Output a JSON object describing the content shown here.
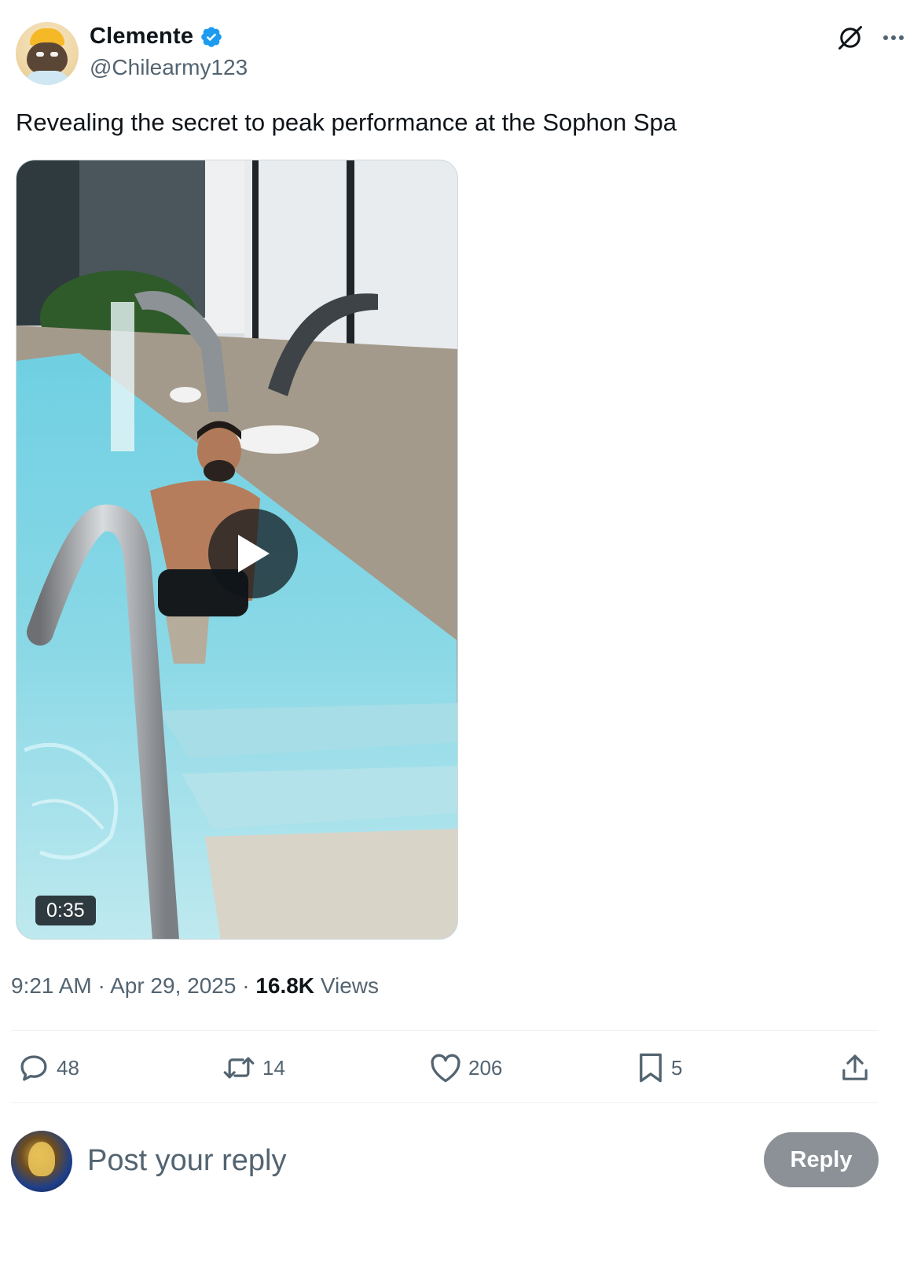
{
  "author": {
    "display_name": "Clemente",
    "handle": "@Chilearmy123",
    "verified": true
  },
  "icons": {
    "verified": "verified-badge-icon",
    "grok": "grok-icon",
    "more": "more-icon",
    "reply": "reply-icon",
    "repost": "repost-icon",
    "like": "like-icon",
    "bookmark": "bookmark-icon",
    "share": "share-icon",
    "play": "play-icon"
  },
  "post": {
    "text": "Revealing the secret to peak performance at the Sophon Spa",
    "video": {
      "duration": "0:35"
    },
    "time": "9:21 AM",
    "separator": "·",
    "date": "Apr 29, 2025",
    "views_count": "16.8K",
    "views_label": "Views"
  },
  "stats": {
    "replies": "48",
    "reposts": "14",
    "likes": "206",
    "bookmarks": "5"
  },
  "reply_box": {
    "placeholder": "Post your reply",
    "button_label": "Reply"
  },
  "colors": {
    "text_primary": "#0f1419",
    "text_secondary": "#536471",
    "verified_blue": "#1d9bf0",
    "divider": "#eff3f4",
    "reply_button_disabled": "#8b9196"
  }
}
